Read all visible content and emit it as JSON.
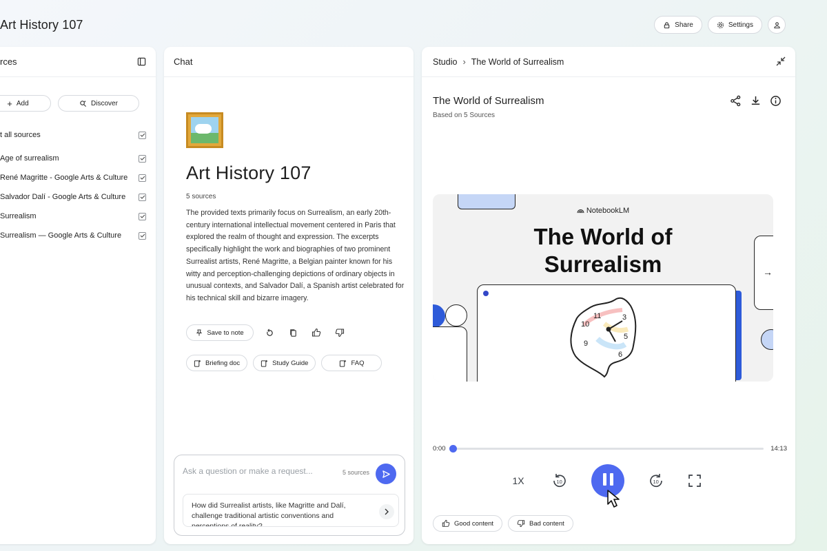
{
  "app": {
    "title": "Art History 107"
  },
  "header": {
    "share_label": "Share",
    "settings_label": "Settings"
  },
  "sources": {
    "title": "rces",
    "add_label": "Add",
    "discover_label": "Discover",
    "select_all_label": "t all sources",
    "items": [
      {
        "label": "Age of surrealism"
      },
      {
        "label": "René Magritte - Google Arts & Culture"
      },
      {
        "label": "Salvador Dalí - Google Arts & Culture"
      },
      {
        "label": "Surrealism"
      },
      {
        "label": "Surrealism — Google Arts & Culture"
      }
    ]
  },
  "chat": {
    "title": "Chat",
    "notebook_title": "Art History 107",
    "source_count": "5 sources",
    "summary": "The provided texts primarily focus on Surrealism, an early 20th-century international intellectual movement centered in Paris that explored the realm of thought and expression. The excerpts specifically highlight the work and biographies of two prominent Surrealist artists, René Magritte, a Belgian painter known for his witty and perception-challenging depictions of ordinary objects in unusual contexts, and Salvador Dalí, a Spanish artist celebrated for his technical skill and bizarre imagery.",
    "save_to_note_label": "Save to note",
    "notes": [
      {
        "label": "Briefing doc"
      },
      {
        "label": "Study Guide"
      },
      {
        "label": "FAQ"
      }
    ],
    "composer": {
      "placeholder": "Ask a question or make a request...",
      "source_count": "5 sources",
      "suggestion": "How did Surrealist artists, like Magritte and Dalí, challenge traditional artistic conventions and perceptions of reality?"
    }
  },
  "studio": {
    "breadcrumb_root": "Studio",
    "breadcrumb_current": "The World of Surrealism",
    "title": "The World of Surrealism",
    "subtitle": "Based on 5 Sources",
    "preview": {
      "brand": "NotebookLM",
      "title_line1": "The World of",
      "title_line2": "Surrealism"
    },
    "player": {
      "current_time": "0:00",
      "total_time": "14:13",
      "progress": 0.0,
      "speed": "1X"
    },
    "feedback": {
      "good_label": "Good content",
      "bad_label": "Bad content"
    }
  },
  "colors": {
    "accent": "#4e69f0"
  }
}
